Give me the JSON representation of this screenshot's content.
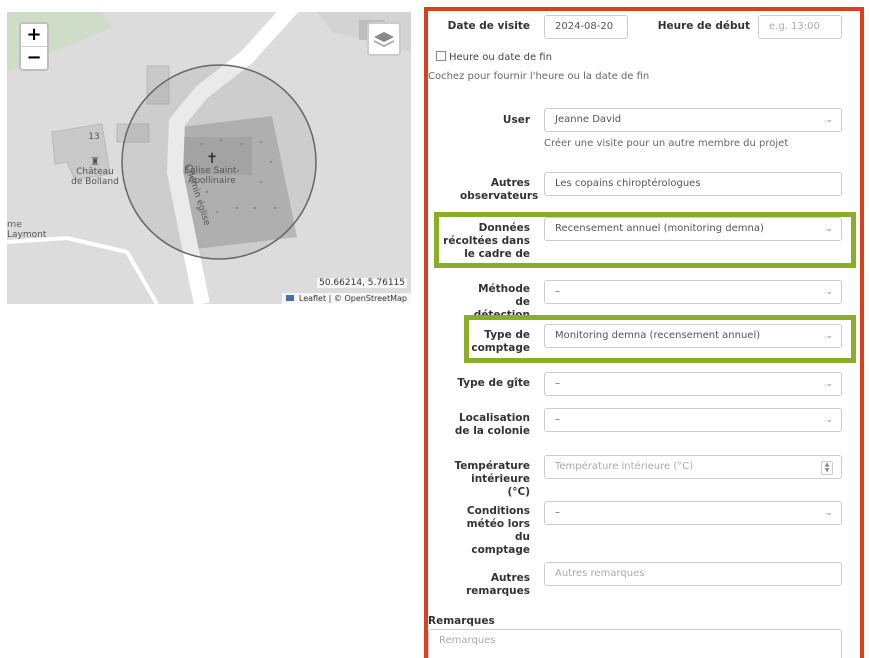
{
  "map": {
    "zoom_in": "+",
    "zoom_out": "−",
    "labels": {
      "chateau": "Château\nde Bolland",
      "eglise": "Église Saint-\nApollinaire",
      "chemin": "Chemin église",
      "left_edge": "rne\nLaymont",
      "small_num": "13"
    },
    "coords": "50.66214, 5.76115",
    "attribution": "Leaflet | © OpenStreetMap"
  },
  "form": {
    "date_label": "Date de visite",
    "date_value": "2024-08-20",
    "start_label": "Heure de début",
    "start_placeholder": "e.g. 13:00",
    "end_checkbox_label": "Heure ou date de fin",
    "end_hint": "Cochez pour fournir l'heure ou la date de fin",
    "user_label": "User",
    "user_value": "Jeanne David",
    "user_hint": "Créer une visite pour un autre membre du projet",
    "observers_label": "Autres observateurs",
    "observers_value": "Les copains chiroptérologues",
    "context_label": "Données récoltées dans le cadre de",
    "context_value": "Recensement annuel (monitoring demna)",
    "method_label": "Méthode de détection",
    "method_value": "–",
    "count_type_label": "Type de comptage",
    "count_type_value": "Monitoring demna (recensement annuel)",
    "roost_label": "Type de gîte",
    "roost_value": "–",
    "colony_label": "Localisation de la colonie",
    "colony_value": "–",
    "temp_label": "Température intérieure (°C)",
    "temp_placeholder": "Température intérieure (°C)",
    "weather_label": "Conditions météo lors du comptage",
    "weather_value": "–",
    "other_label": "Autres remarques",
    "other_placeholder": "Autres remarques",
    "remarks_label": "Remarques",
    "remarks_placeholder": "Remarques"
  }
}
